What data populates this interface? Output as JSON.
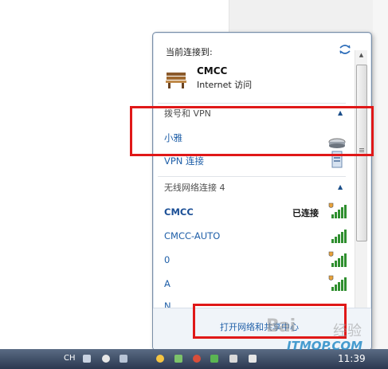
{
  "flyout": {
    "connected_header": "当前连接到:",
    "current_network": {
      "name": "CMCC",
      "access": "Internet 访问"
    },
    "dialup_section": {
      "label": "拨号和 VPN",
      "items": [
        {
          "name": "小雅"
        },
        {
          "name": "VPN 连接"
        }
      ]
    },
    "wireless_section": {
      "label": "无线网络连接 4",
      "items": [
        {
          "name": "CMCC",
          "status": "已连接"
        },
        {
          "name": "CMCC-AUTO"
        },
        {
          "name": "0"
        },
        {
          "name": "A"
        },
        {
          "name": "N"
        }
      ]
    },
    "footer_link": "打开网络和共享中心"
  },
  "watermark": {
    "logo": "Bai",
    "sub": "经验",
    "site": "ITMOP.COM"
  },
  "taskbar": {
    "lang": "CH",
    "clock": "11:39"
  },
  "colors": {
    "link": "#1f5fa8",
    "highlight": "#e01818",
    "signal": "#2f8f2f"
  }
}
